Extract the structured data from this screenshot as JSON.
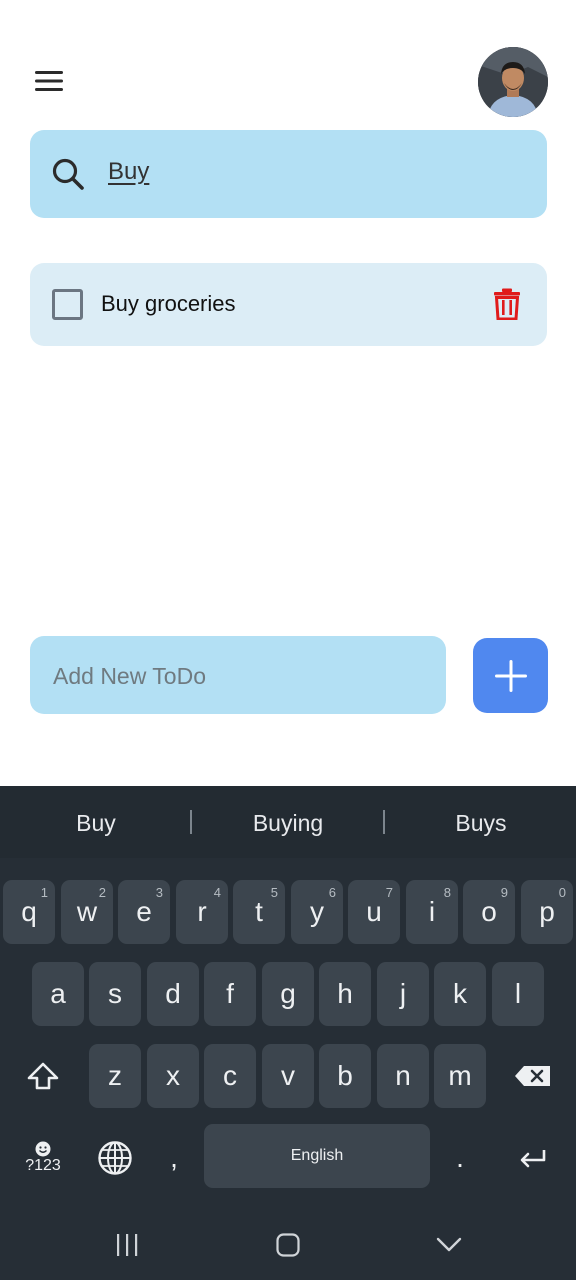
{
  "search": {
    "query": "Buy"
  },
  "todos": [
    {
      "text": "Buy groceries",
      "done": false
    }
  ],
  "add_todo": {
    "placeholder": "Add New ToDo"
  },
  "keyboard": {
    "suggestions": [
      "Buy",
      "Buying",
      "Buys"
    ],
    "row1": [
      {
        "char": "q",
        "hint": "1"
      },
      {
        "char": "w",
        "hint": "2"
      },
      {
        "char": "e",
        "hint": "3"
      },
      {
        "char": "r",
        "hint": "4"
      },
      {
        "char": "t",
        "hint": "5"
      },
      {
        "char": "y",
        "hint": "6"
      },
      {
        "char": "u",
        "hint": "7"
      },
      {
        "char": "i",
        "hint": "8"
      },
      {
        "char": "o",
        "hint": "9"
      },
      {
        "char": "p",
        "hint": "0"
      }
    ],
    "row2": [
      "a",
      "s",
      "d",
      "f",
      "g",
      "h",
      "j",
      "k",
      "l"
    ],
    "row3": [
      "z",
      "x",
      "c",
      "v",
      "b",
      "n",
      "m"
    ],
    "symbols_label": "?123",
    "comma": ",",
    "space_label": "English",
    "period": "."
  },
  "colors": {
    "accent": "#5088ef",
    "field": "#b3e0f4",
    "item": "#dcedf6",
    "delete": "#e01b1b",
    "keyboard_bg": "#262e36"
  }
}
